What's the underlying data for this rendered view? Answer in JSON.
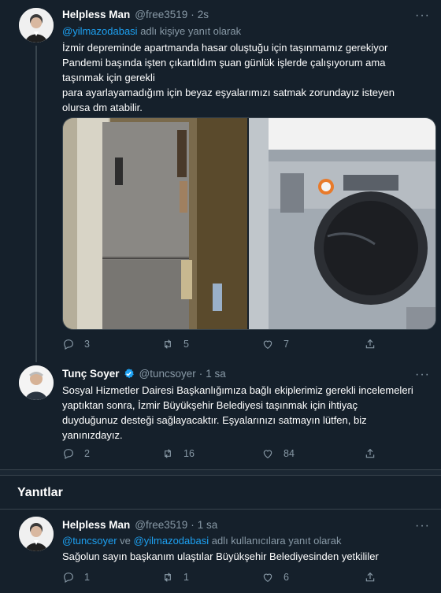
{
  "colors": {
    "background": "#15202b",
    "accent": "#1da1f2",
    "muted": "#8899a6",
    "border": "#38444d"
  },
  "tweet1": {
    "name": "Helpless Man",
    "handle": "@free3519",
    "separator": "·",
    "time": "2s",
    "reply_mention": "@yilmazodabasi",
    "reply_suffix": " adlı kişiye yanıt olarak",
    "lines": [
      "İzmir depreminde apartmanda hasar oluştuğu için taşınmamız gerekiyor",
      "Pandemi başında işten çıkartıldım şuan günlük işlerde çalışıyorum ama",
      "taşınmak için gerekli",
      "para ayarlayamadığım için beyaz eşyalarımızı satmak zorundayız isteyen",
      "olursa dm atabilir."
    ],
    "media": [
      {
        "icon": "refrigerator-photo"
      },
      {
        "icon": "washing-machine-photo"
      }
    ],
    "replies": "3",
    "retweets": "5",
    "likes": "7"
  },
  "tweet2": {
    "name": "Tunç Soyer",
    "handle": "@tuncsoyer",
    "separator": "·",
    "time": "1 sa",
    "lines": [
      "Sosyal Hizmetler Dairesi Başkanlığımıza bağlı ekiplerimiz gerekli incelemeleri",
      "yaptıktan sonra, İzmir Büyükşehir Belediyesi taşınmak için ihtiyaç",
      "duyduğunuz desteği sağlayacaktır. Eşyalarınızı satmayın lütfen, biz",
      "yanınızdayız."
    ],
    "replies": "2",
    "retweets": "16",
    "likes": "84"
  },
  "section": {
    "title": "Yanıtlar"
  },
  "tweet3": {
    "name": "Helpless Man",
    "handle": "@free3519",
    "separator": "·",
    "time": "1 sa",
    "reply_mention1": "@tuncsoyer",
    "reply_and": " ve ",
    "reply_mention2": "@yilmazodabasi",
    "reply_suffix": " adlı kullanıcılara yanıt olarak",
    "text": "Sağolun sayın başkanım ulaştılar Büyükşehir Belediyesinden yetkililer",
    "replies": "1",
    "retweets": "1",
    "likes": "6"
  }
}
